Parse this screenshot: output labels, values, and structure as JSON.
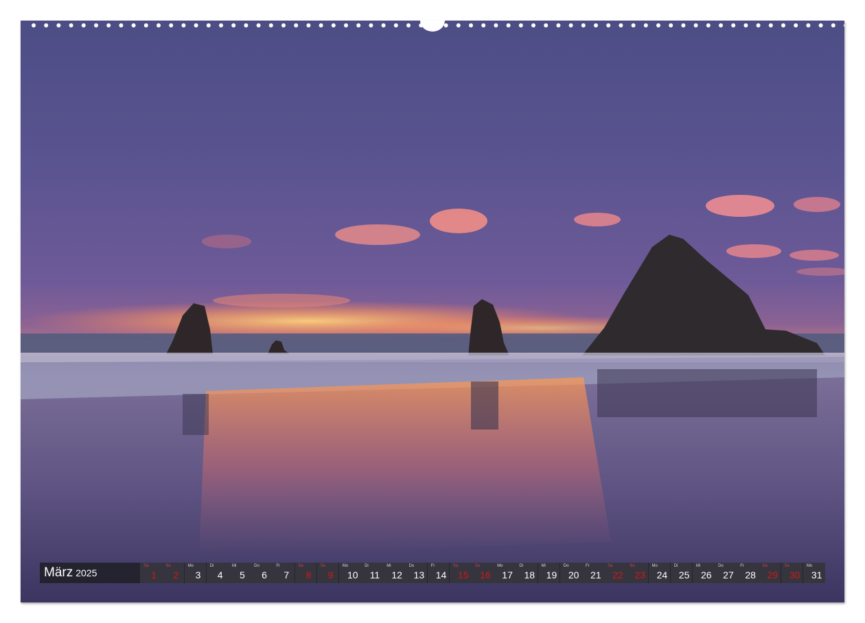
{
  "calendar": {
    "month": "März",
    "year": "2025",
    "days": [
      {
        "wd": "Sa",
        "num": "1",
        "weekend": true
      },
      {
        "wd": "So",
        "num": "2",
        "weekend": true
      },
      {
        "wd": "Mo",
        "num": "3",
        "weekend": false
      },
      {
        "wd": "Di",
        "num": "4",
        "weekend": false
      },
      {
        "wd": "Mi",
        "num": "5",
        "weekend": false
      },
      {
        "wd": "Do",
        "num": "6",
        "weekend": false
      },
      {
        "wd": "Fr",
        "num": "7",
        "weekend": false
      },
      {
        "wd": "Sa",
        "num": "8",
        "weekend": true
      },
      {
        "wd": "So",
        "num": "9",
        "weekend": true
      },
      {
        "wd": "Mo",
        "num": "10",
        "weekend": false
      },
      {
        "wd": "Di",
        "num": "11",
        "weekend": false
      },
      {
        "wd": "Mi",
        "num": "12",
        "weekend": false
      },
      {
        "wd": "Do",
        "num": "13",
        "weekend": false
      },
      {
        "wd": "Fr",
        "num": "14",
        "weekend": false
      },
      {
        "wd": "Sa",
        "num": "15",
        "weekend": true
      },
      {
        "wd": "So",
        "num": "16",
        "weekend": true
      },
      {
        "wd": "Mo",
        "num": "17",
        "weekend": false
      },
      {
        "wd": "Di",
        "num": "18",
        "weekend": false
      },
      {
        "wd": "Mi",
        "num": "19",
        "weekend": false
      },
      {
        "wd": "Do",
        "num": "20",
        "weekend": false
      },
      {
        "wd": "Fr",
        "num": "21",
        "weekend": false
      },
      {
        "wd": "Sa",
        "num": "22",
        "weekend": true
      },
      {
        "wd": "So",
        "num": "23",
        "weekend": true
      },
      {
        "wd": "Mo",
        "num": "24",
        "weekend": false
      },
      {
        "wd": "Di",
        "num": "25",
        "weekend": false
      },
      {
        "wd": "Mi",
        "num": "26",
        "weekend": false
      },
      {
        "wd": "Do",
        "num": "27",
        "weekend": false
      },
      {
        "wd": "Fr",
        "num": "28",
        "weekend": false
      },
      {
        "wd": "Sa",
        "num": "29",
        "weekend": true
      },
      {
        "wd": "So",
        "num": "30",
        "weekend": true
      },
      {
        "wd": "Mo",
        "num": "31",
        "weekend": false
      }
    ]
  },
  "colors": {
    "weekend": "#d01818",
    "bar": "#1e1e26"
  }
}
